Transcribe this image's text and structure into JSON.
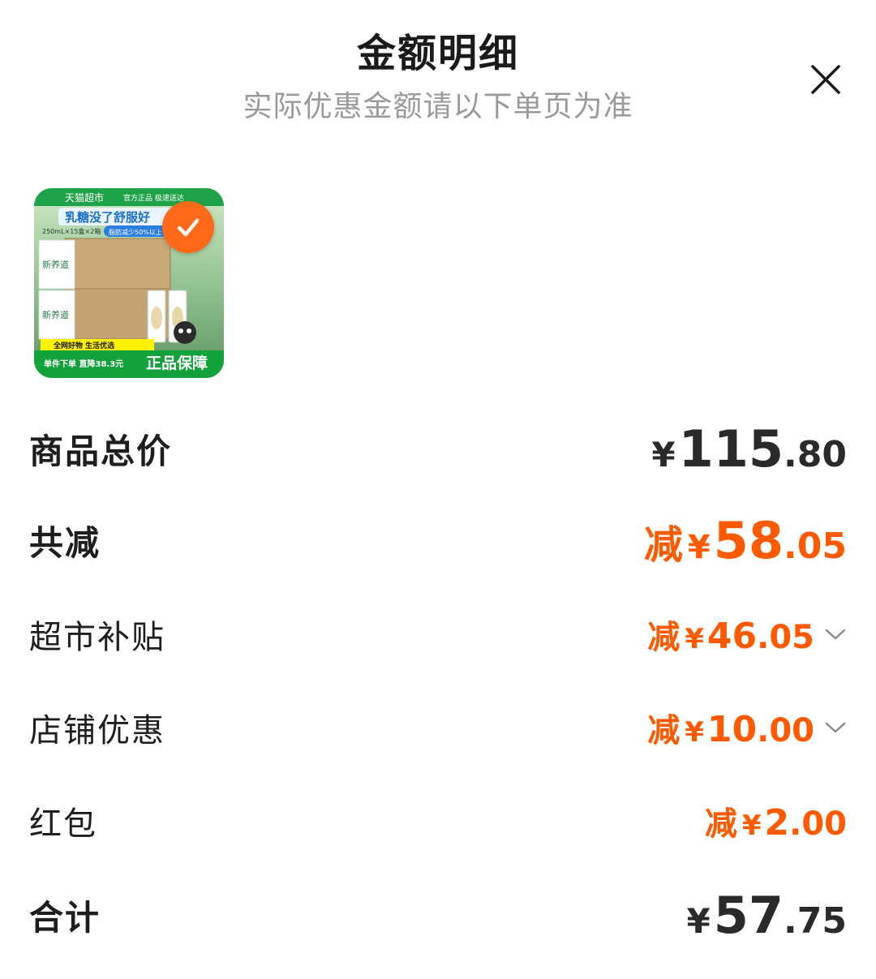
{
  "header": {
    "title": "金额明细",
    "subtitle": "实际优惠金额请以下单页为准"
  },
  "product": {
    "image_texts": {
      "store": "天猫超市",
      "tags": "官方正品 极速送达",
      "headline": "乳糖没了舒服好",
      "spec": "250mL×15盒×2箱",
      "fat": "脂肪减少50%以上",
      "brand": "新养道",
      "banner_top": "全网好物 生活优选",
      "banner_left": "单件下单 直降38.3元",
      "banner_right": "正品保障"
    },
    "selected": true
  },
  "rows": [
    {
      "label": "商品总价",
      "prefix": "",
      "yen": "¥",
      "int": "115",
      "dec": ".80"
    },
    {
      "label": "共减",
      "prefix": "减",
      "yen": "¥",
      "int": "58",
      "dec": ".05"
    },
    {
      "label": "超市补贴",
      "prefix": "减",
      "yen": "¥",
      "int": "46",
      "dec": ".05",
      "expandable": true
    },
    {
      "label": "店铺优惠",
      "prefix": "减",
      "yen": "¥",
      "int": "10",
      "dec": ".00",
      "expandable": true
    },
    {
      "label": "红包",
      "prefix": "减",
      "yen": "¥",
      "int": "2",
      "dec": ".00"
    },
    {
      "label": "合计",
      "prefix": "",
      "yen": "¥",
      "int": "57",
      "dec": ".75"
    }
  ],
  "colors": {
    "accent": "#ff5a00",
    "text": "#1e1e1e",
    "subtle": "#9a9a9a"
  },
  "icons": [
    "close-icon",
    "checkmark-icon",
    "chevron-down-icon"
  ]
}
